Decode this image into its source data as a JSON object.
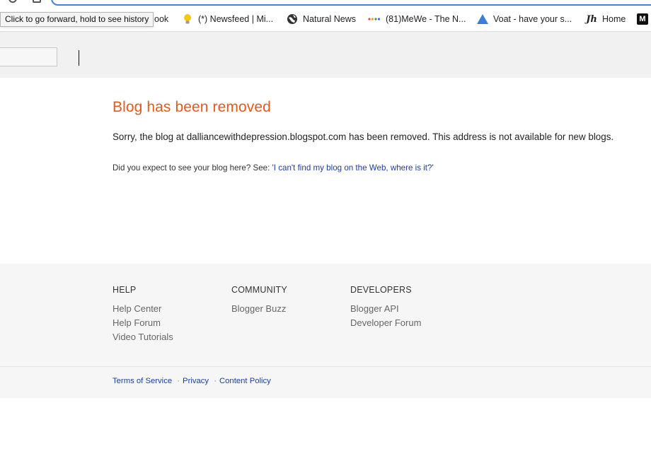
{
  "browser": {
    "tooltip": "Click to go forward, hold to see history",
    "bookmarks": [
      {
        "label": "ook",
        "icon": "none"
      },
      {
        "label": "(*) Newsfeed | Mi...",
        "icon": "lightbulb-icon"
      },
      {
        "label": "Natural News",
        "icon": "globe-icon"
      },
      {
        "label": "(81)MeWe - The N...",
        "icon": "dots-icon"
      },
      {
        "label": "Voat - have your s...",
        "icon": "triangle-icon"
      },
      {
        "label": "Home",
        "icon": "jh-logo-icon"
      }
    ],
    "bookmark_icon_text": {
      "jh": "Jh",
      "m": "M"
    }
  },
  "main": {
    "title": "Blog has been removed",
    "message": "Sorry, the blog at dalliancewithdepression.blogspot.com has been removed. This address is not available for new blogs.",
    "hint_prefix": "Did you expect to see your blog here? See: '",
    "hint_link": "I can't find my blog on the Web, where is it?",
    "hint_suffix": "'"
  },
  "footer": {
    "columns": [
      {
        "heading": "HELP",
        "links": [
          "Help Center",
          "Help Forum",
          "Video Tutorials"
        ]
      },
      {
        "heading": "COMMUNITY",
        "links": [
          "Blogger Buzz"
        ]
      },
      {
        "heading": "DEVELOPERS",
        "links": [
          "Blogger API",
          "Developer Forum"
        ]
      }
    ],
    "legal": {
      "terms": "Terms of Service",
      "privacy": "Privacy",
      "content_policy": "Content Policy",
      "separator": "·"
    }
  },
  "colors": {
    "title": "#e45a1b",
    "link": "#1a3f9e",
    "header_band": "#f1f1f1",
    "footer_bg": "#f6f6f6",
    "url_focus": "#4a7fe0"
  }
}
